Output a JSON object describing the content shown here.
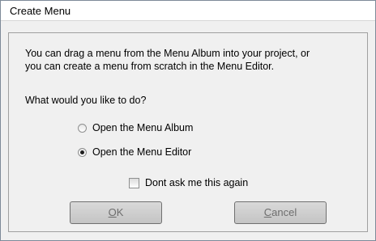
{
  "window": {
    "title": "Create Menu"
  },
  "message": {
    "line1": "You can drag a menu from the Menu Album into your project, or",
    "line2": "you can create a menu from scratch in the Menu Editor."
  },
  "question": "What would you like to do?",
  "options": [
    {
      "label": "Open the Menu Album",
      "selected": false
    },
    {
      "label": "Open the Menu Editor",
      "selected": true
    }
  ],
  "dont_ask": {
    "label": "Dont ask me this again",
    "checked": false
  },
  "buttons": {
    "ok": {
      "mnemonic": "O",
      "rest": "K"
    },
    "cancel": {
      "mnemonic": "C",
      "rest": "ancel"
    }
  }
}
